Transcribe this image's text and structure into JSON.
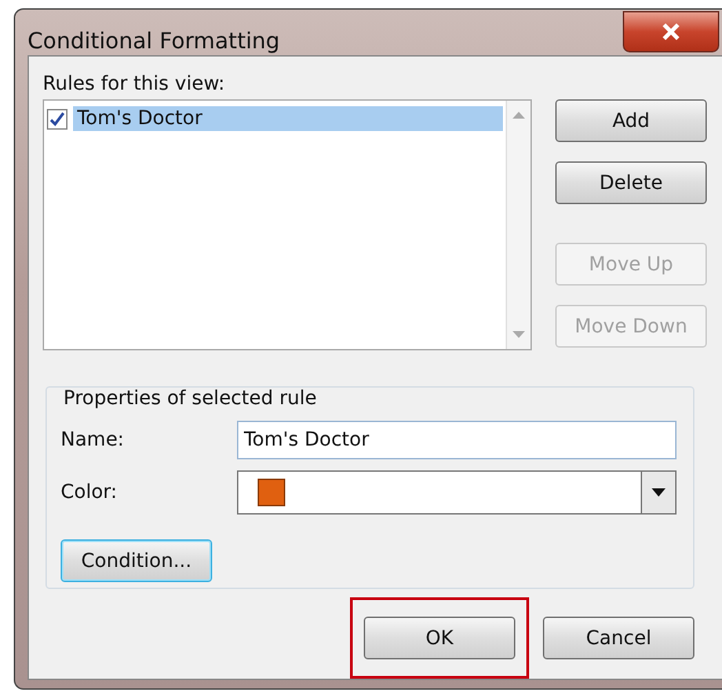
{
  "window": {
    "title": "Conditional Formatting"
  },
  "rules_label": "Rules for this view:",
  "rules": [
    {
      "name": "Tom's Doctor",
      "checked": true,
      "selected": true
    }
  ],
  "side_buttons": [
    {
      "label": "Add",
      "disabled": false
    },
    {
      "label": "Delete",
      "disabled": false
    },
    {
      "label": "Move Up",
      "disabled": true
    },
    {
      "label": "Move Down",
      "disabled": true
    }
  ],
  "properties": {
    "title": "Properties of selected rule",
    "name_label": "Name:",
    "name_value": "Tom's Doctor",
    "color_label": "Color:",
    "color": "#e06010",
    "condition_button": "Condition..."
  },
  "footer_buttons": [
    {
      "label": "OK",
      "highlighted": true
    },
    {
      "label": "Cancel",
      "highlighted": false
    }
  ]
}
